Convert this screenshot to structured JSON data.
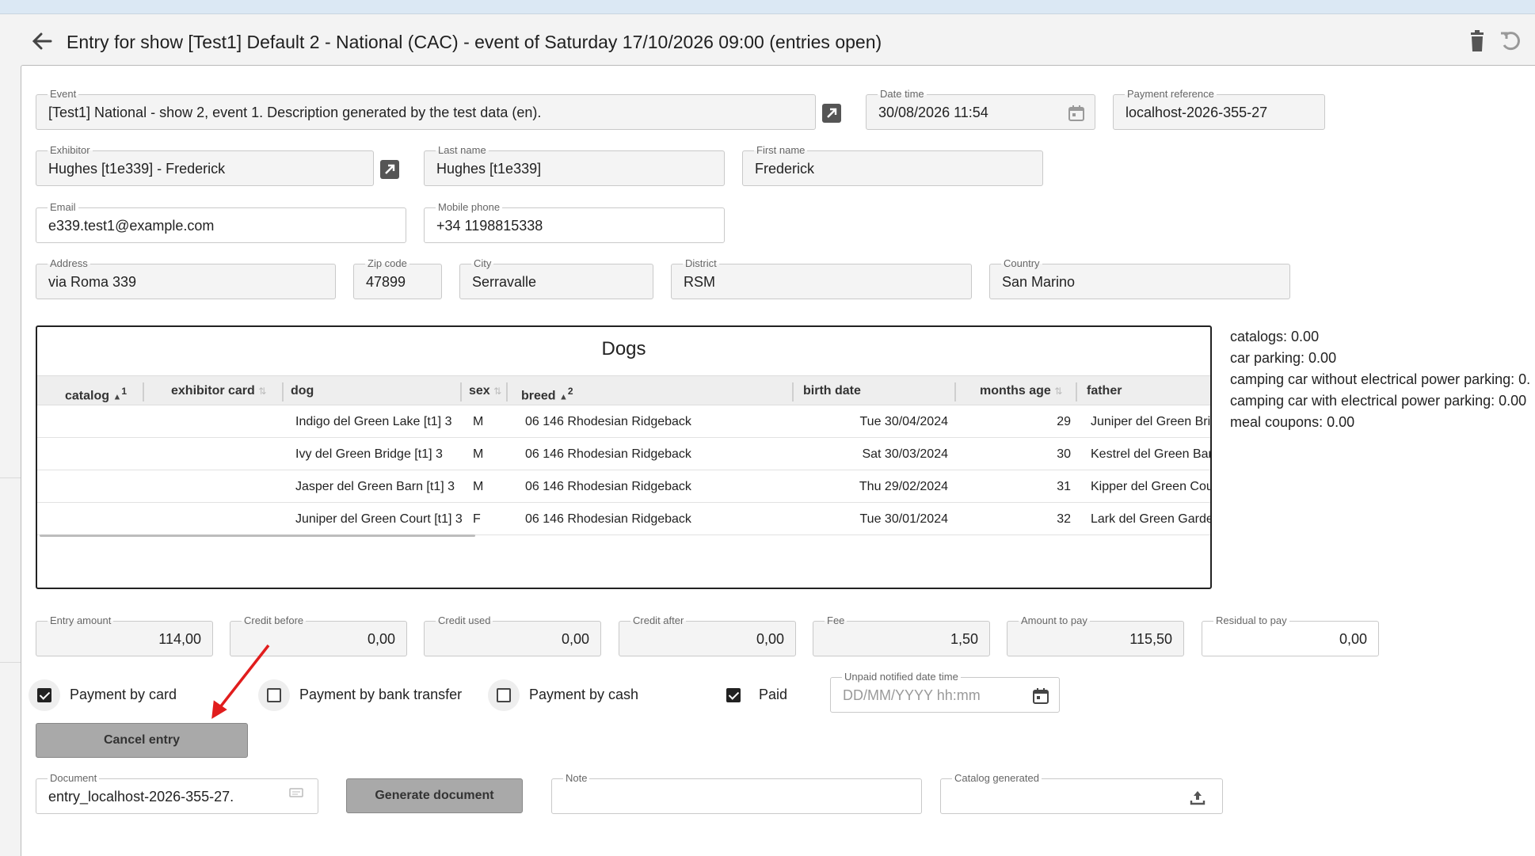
{
  "header": {
    "title": "Entry for show [Test1] Default 2 - National (CAC) - event of Saturday 17/10/2026 09:00 (entries open)"
  },
  "icons": {
    "back": "arrow-left-icon",
    "delete": "trash-icon",
    "undo": "undo-icon",
    "calendar": "calendar-icon",
    "open_link": "open-in-new-icon",
    "file": "file-icon",
    "upload": "upload-icon"
  },
  "form": {
    "event": {
      "label": "Event",
      "value": "[Test1] National - show 2, event 1. Description generated by the test data (en)."
    },
    "date_time": {
      "label": "Date time",
      "value": "30/08/2026 11:54"
    },
    "payment_reference": {
      "label": "Payment reference",
      "value": "localhost-2026-355-27"
    },
    "exhibitor": {
      "label": "Exhibitor",
      "value": "Hughes [t1e339] - Frederick"
    },
    "last_name": {
      "label": "Last name",
      "value": "Hughes [t1e339]"
    },
    "first_name": {
      "label": "First name",
      "value": "Frederick"
    },
    "email": {
      "label": "Email",
      "value": "e339.test1@example.com"
    },
    "mobile_phone": {
      "label": "Mobile phone",
      "value": "+34 1198815338"
    },
    "address": {
      "label": "Address",
      "value": "via Roma 339"
    },
    "zip_code": {
      "label": "Zip code",
      "value": "47899"
    },
    "city": {
      "label": "City",
      "value": "Serravalle"
    },
    "district": {
      "label": "District",
      "value": "RSM"
    },
    "country": {
      "label": "Country",
      "value": "San Marino"
    }
  },
  "dogs": {
    "title": "Dogs",
    "columns": {
      "catalog": "catalog",
      "catalog_sort": "1",
      "exhibitor_card": "exhibitor card",
      "dog": "dog",
      "sex": "sex",
      "breed": "breed",
      "breed_sort": "2",
      "birth_date": "birth date",
      "months_age": "months age",
      "father": "father"
    },
    "rows": [
      {
        "dog": "Indigo del Green Lake [t1] 3",
        "sex": "M",
        "breed": "06 146 Rhodesian Ridgeback",
        "birth_date": "Tue 30/04/2024",
        "months_age": "29",
        "father": "Juniper del Green Bric"
      },
      {
        "dog": "Ivy del Green Bridge [t1] 3",
        "sex": "M",
        "breed": "06 146 Rhodesian Ridgeback",
        "birth_date": "Sat 30/03/2024",
        "months_age": "30",
        "father": "Kestrel del Green Barr"
      },
      {
        "dog": "Jasper del Green Barn [t1] 3",
        "sex": "M",
        "breed": "06 146 Rhodesian Ridgeback",
        "birth_date": "Thu 29/02/2024",
        "months_age": "31",
        "father": "Kipper del Green Cour"
      },
      {
        "dog": "Juniper del Green Court [t1] 3",
        "sex": "F",
        "breed": "06 146 Rhodesian Ridgeback",
        "birth_date": "Tue 30/01/2024",
        "months_age": "32",
        "father": "Lark del Green Garder"
      }
    ]
  },
  "summary": [
    "catalogs: 0.00",
    "car parking: 0.00",
    "camping car without electrical power parking: 0.",
    "camping car with electrical power parking: 0.00",
    "meal coupons: 0.00"
  ],
  "amounts": {
    "entry_amount": {
      "label": "Entry amount",
      "value": "114,00"
    },
    "credit_before": {
      "label": "Credit before",
      "value": "0,00"
    },
    "credit_used": {
      "label": "Credit used",
      "value": "0,00"
    },
    "credit_after": {
      "label": "Credit after",
      "value": "0,00"
    },
    "fee": {
      "label": "Fee",
      "value": "1,50"
    },
    "amount_to_pay": {
      "label": "Amount to pay",
      "value": "115,50"
    },
    "residual_to_pay": {
      "label": "Residual to pay",
      "value": "0,00"
    }
  },
  "payment": {
    "card": {
      "label": "Payment by card",
      "checked": true
    },
    "bank_transfer": {
      "label": "Payment by bank transfer",
      "checked": false
    },
    "cash": {
      "label": "Payment by cash",
      "checked": false
    },
    "paid": {
      "label": "Paid",
      "checked": true
    },
    "unpaid_notified": {
      "label": "Unpaid notified date time",
      "placeholder": "DD/MM/YYYY hh:mm"
    }
  },
  "actions": {
    "cancel_entry": "Cancel entry",
    "generate_document": "Generate document"
  },
  "documents": {
    "document": {
      "label": "Document",
      "value": "entry_localhost-2026-355-27."
    },
    "note": {
      "label": "Note",
      "value": ""
    },
    "catalog_generated": {
      "label": "Catalog generated",
      "value": ""
    }
  },
  "colors": {
    "annotation_arrow": "#e11d1d",
    "button_gray": "#a9a9a9"
  }
}
